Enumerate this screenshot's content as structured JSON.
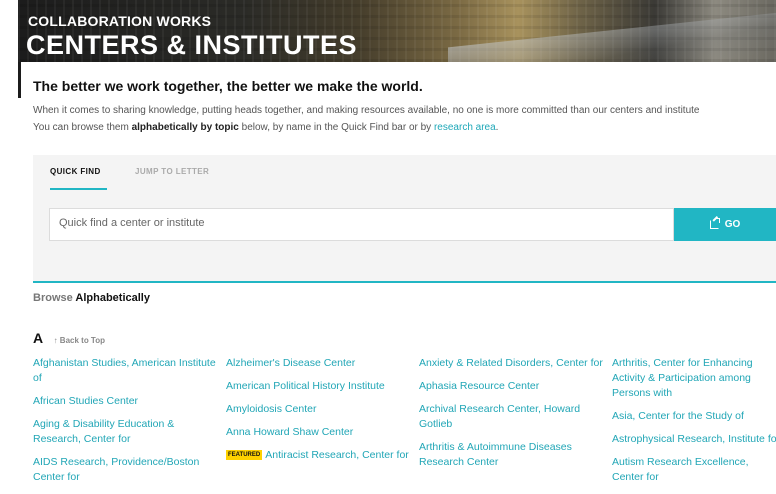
{
  "hero": {
    "kicker": "COLLABORATION WORKS",
    "title": "CENTERS & INSTITUTES"
  },
  "intro": {
    "tagline": "The better we work together, the better we make the world.",
    "line1": "When it comes to sharing knowledge, putting heads together, and making resources available, no one is more committed than our centers and institute",
    "line2_pre": "You can browse them ",
    "line2_bold": "alphabetically by topic",
    "line2_mid": " below, by name in the Quick Find bar or by ",
    "line2_link": "research area",
    "line2_post": "."
  },
  "quickfind": {
    "tabs": [
      "QUICK FIND",
      "JUMP TO LETTER"
    ],
    "placeholder": "Quick find a center or institute",
    "go_label": "GO",
    "accent_color": "#21b6c4"
  },
  "browse": {
    "heading_muted": "Browse",
    "heading_bold": "Alphabetically",
    "letter": "A",
    "back_to_top": "↑ Back to Top",
    "featured_badge": "FEATURED",
    "columns": [
      [
        "Afghanistan Studies, American Institute of",
        "African Studies Center",
        "Aging & Disability Education & Research, Center for",
        "AIDS Research, Providence/Boston Center for"
      ],
      [
        "Alzheimer's Disease Center",
        "American Political History Institute",
        "Amyloidosis Center",
        "Anna Howard Shaw Center",
        "Antiracist Research, Center for"
      ],
      [
        "Anxiety & Related Disorders, Center for",
        "Aphasia Resource Center",
        "Archival Research Center, Howard Gotlieb",
        "Arthritis & Autoimmune Diseases Research Center"
      ],
      [
        "Arthritis, Center for Enhancing Activity & Participation among Persons with",
        "Asia, Center for the Study of",
        "Astrophysical Research, Institute for",
        "Autism Research Excellence, Center for"
      ]
    ]
  }
}
